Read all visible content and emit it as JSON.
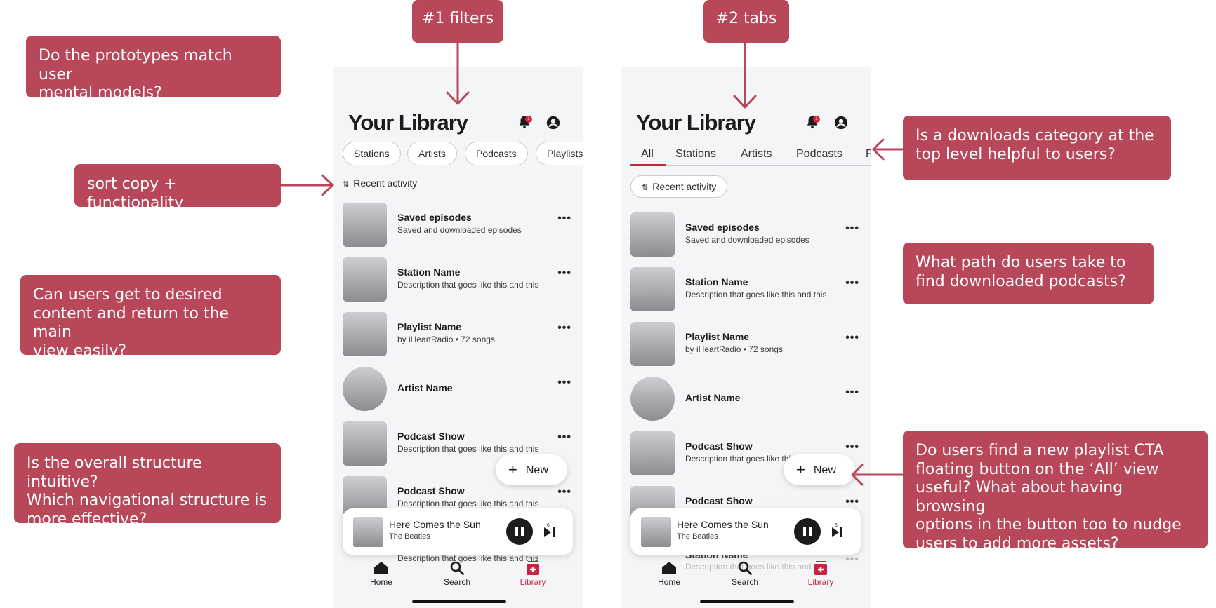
{
  "colors": {
    "accent": "#b8475a",
    "brand_red": "#c2273f",
    "phone_bg": "#f4f5f7"
  },
  "labels": {
    "filters": "#1 filters",
    "tabs": "#2 tabs"
  },
  "notes": {
    "mental_models": [
      "Do the prototypes match user",
      "mental models?"
    ],
    "sort": [
      "sort copy + functionality"
    ],
    "navigation": [
      "Can users get to desired",
      "content and return to the main",
      "view easily?"
    ],
    "structure": [
      "Is the overall structure intuitive?",
      "Which navigational structure is",
      "more effective?"
    ],
    "downloads_category": [
      "Is a downloads category at the",
      "top level helpful to users?"
    ],
    "downloads_path": [
      "What path do users take to",
      "find downloaded podcasts?"
    ],
    "fab": [
      "Do users find a new playlist CTA",
      "floating button on the ‘All’ view",
      "useful? What about having browsing",
      "options in the button too to nudge",
      "users to add more assets?"
    ]
  },
  "library": {
    "title": "Your Library",
    "notification_count": "1",
    "chips": [
      "Stations",
      "Artists",
      "Podcasts",
      "Playlists"
    ],
    "tabs": [
      "All",
      "Stations",
      "Artists",
      "Podcasts",
      "P"
    ],
    "sort_label": "Recent activity",
    "items": [
      {
        "title": "Saved episodes",
        "subtitle": "Saved and downloaded episodes"
      },
      {
        "title": "Station Name",
        "subtitle": "Description that goes like this and this"
      },
      {
        "title": "Playlist Name",
        "subtitle": "by iHeartRadio • 72 songs"
      },
      {
        "title": "Artist Name",
        "subtitle": ""
      },
      {
        "title": "Podcast Show",
        "subtitle": "Description that goes like this and this"
      },
      {
        "title": "Podcast Show",
        "subtitle": "Description that goes like this and this"
      }
    ],
    "right_item5_subtitle": "Description that goes like this",
    "right_item5_tail": "and this",
    "under_player_a": "Description that goes like this and this",
    "under_player_b_title": "Station Name",
    "under_player_b_sub": "Description that goes like this and this",
    "fab_label": "New",
    "player": {
      "title": "Here Comes the Sun",
      "artist": "The Beatles",
      "skip_count": "6"
    },
    "nav": [
      "Home",
      "Search",
      "Library"
    ]
  }
}
